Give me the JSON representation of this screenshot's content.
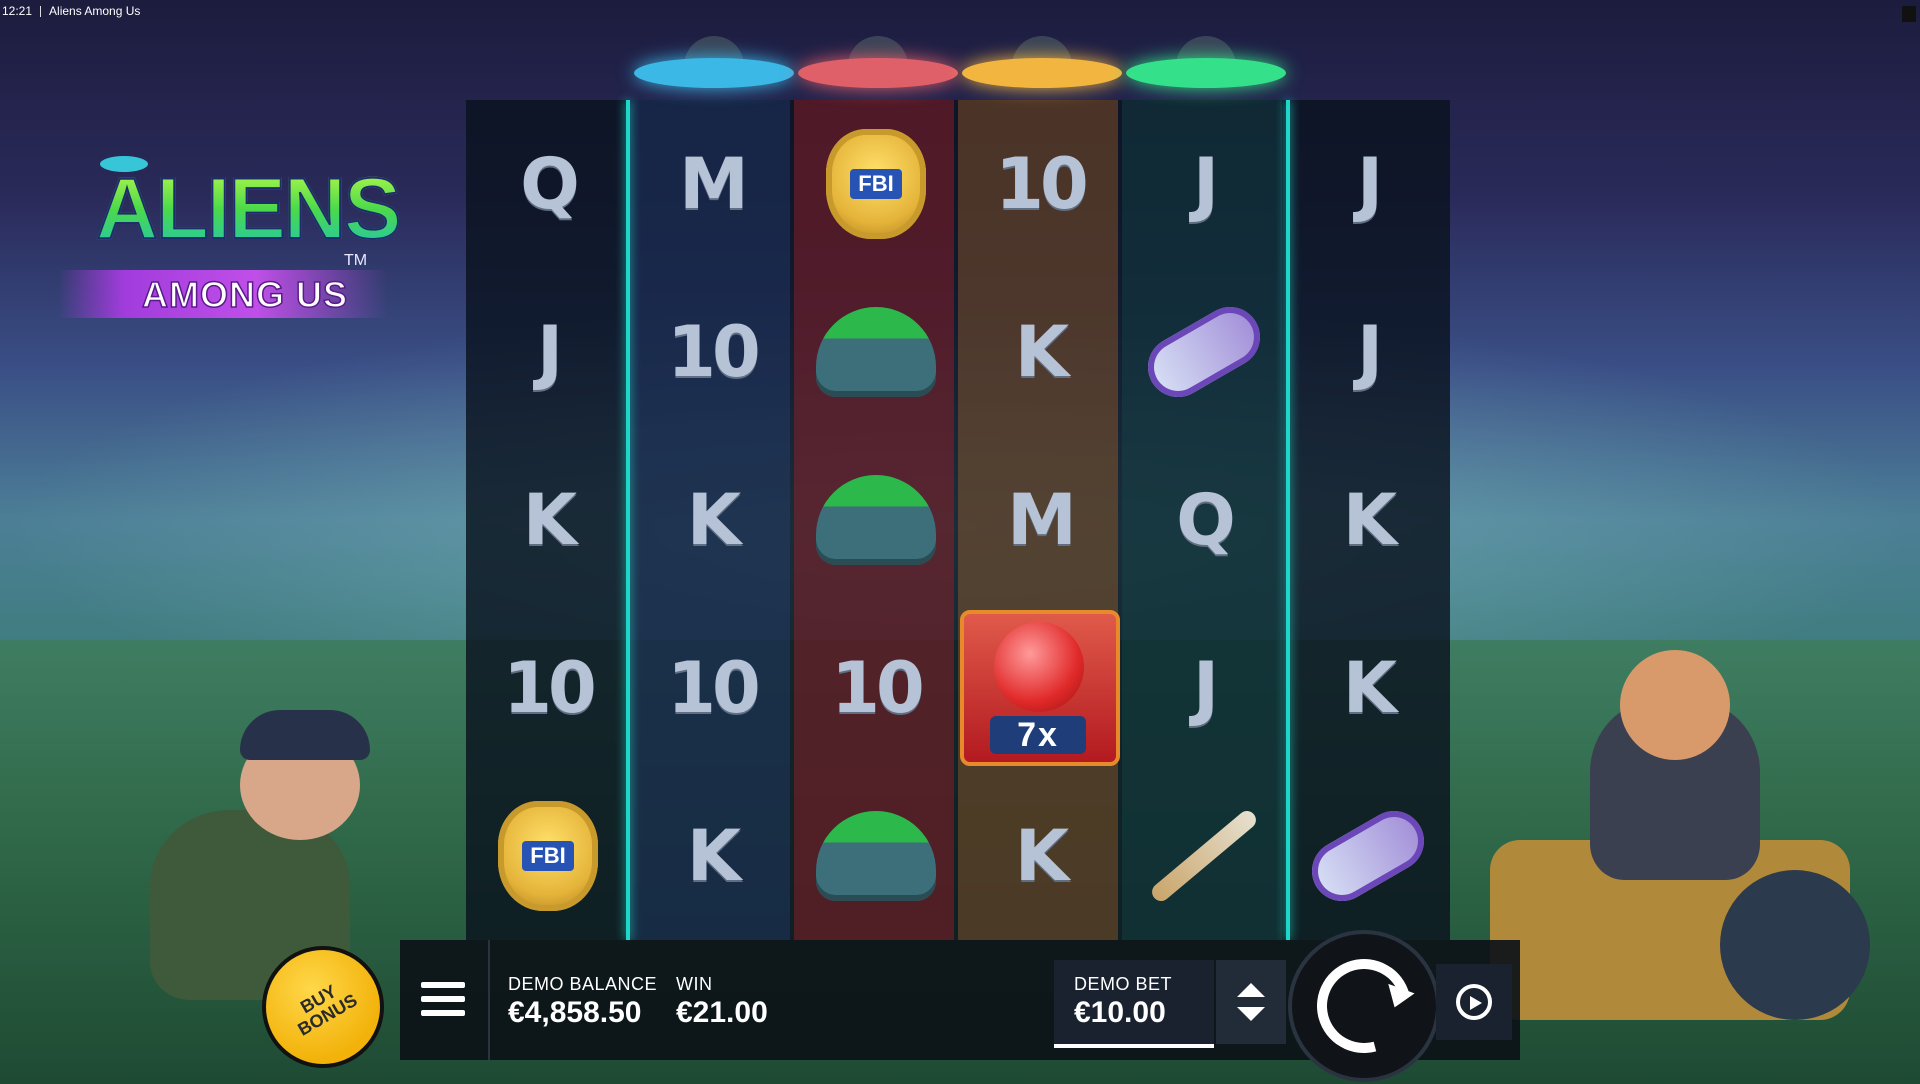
{
  "window": {
    "time": "12:21",
    "title": "Aliens Among Us"
  },
  "logo": {
    "main": "ALIENS",
    "sub": "AMONG US",
    "tm": "TM"
  },
  "reels": [
    [
      "Q",
      "J",
      "K",
      "10",
      "fbi-badge"
    ],
    [
      "M",
      "10",
      "K",
      "10",
      "K"
    ],
    [
      "fbi-badge",
      "slime-cap",
      "slime-cap",
      "10",
      "slime-cap"
    ],
    [
      "10",
      "K",
      "M",
      "alien-multiplier",
      "K"
    ],
    [
      "J",
      "raygun",
      "Q",
      "J",
      "spiked-bat"
    ],
    [
      "J",
      "J",
      "K",
      "K",
      "raygun"
    ]
  ],
  "symbols": {
    "fbi_text": "FBI",
    "multiplier": "7x"
  },
  "ufo_colors": [
    "#3bb8e6",
    "#e0606a",
    "#f2b640",
    "#35e08a"
  ],
  "colors": {
    "reel_divider": "#1fd6c8",
    "buy_bonus": "#f2b20a"
  },
  "buy_bonus": {
    "label": "BUY BONUS"
  },
  "bottom_bar": {
    "balance_label": "DEMO BALANCE",
    "balance_value": "€4,858.50",
    "win_label": "WIN",
    "win_value": "€21.00",
    "bet_label": "DEMO BET",
    "bet_value": "€10.00"
  }
}
